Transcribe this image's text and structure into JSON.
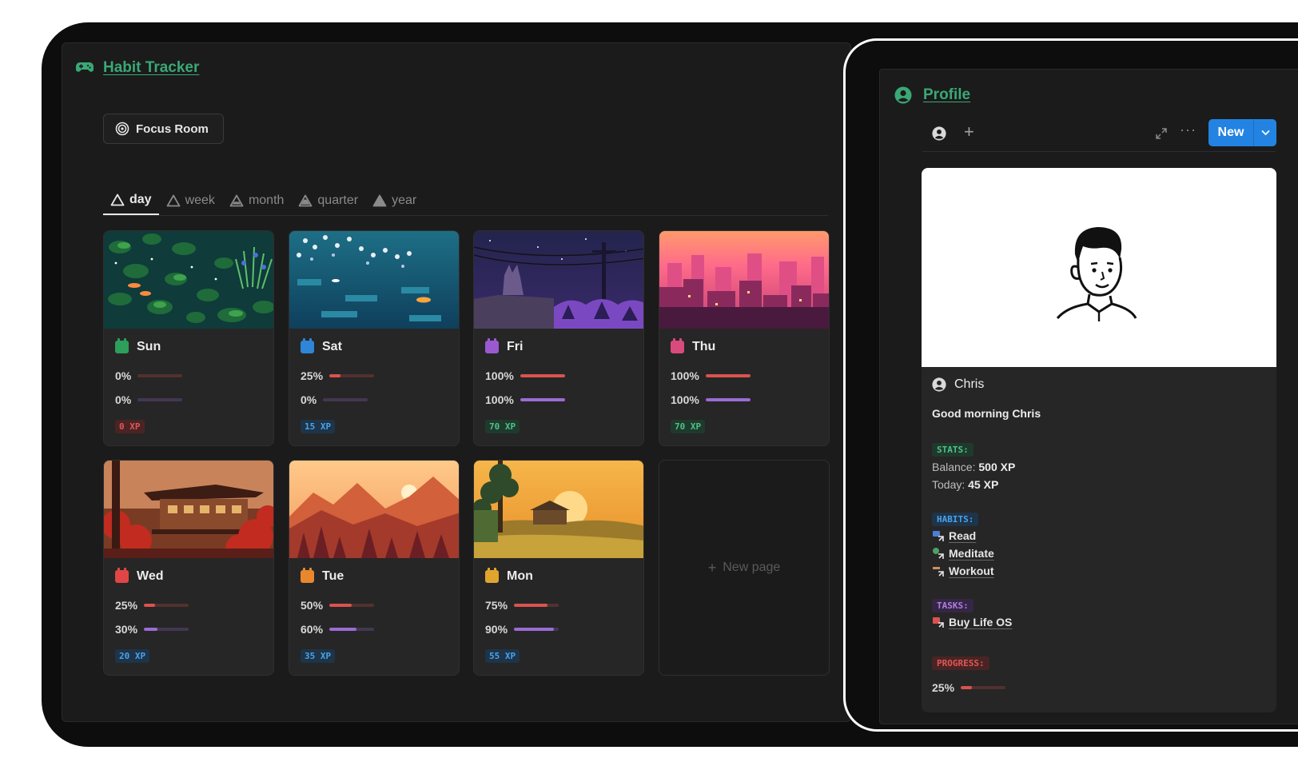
{
  "app": {
    "title": "Habit Tracker",
    "focus_button": "Focus Room"
  },
  "tabs": [
    {
      "label": "day",
      "active": true
    },
    {
      "label": "week",
      "active": false
    },
    {
      "label": "month",
      "active": false
    },
    {
      "label": "quarter",
      "active": false
    },
    {
      "label": "year",
      "active": false
    }
  ],
  "days": [
    {
      "name": "Sun",
      "p1_text": "0%",
      "p1": 0,
      "p2_text": "0%",
      "p2": 0,
      "xp": "0 XP",
      "cal_color": "#2e9e5b",
      "xp_color": "#e05757",
      "xp_bg": "#4a2424"
    },
    {
      "name": "Sat",
      "p1_text": "25%",
      "p1": 0.25,
      "p2_text": "0%",
      "p2": 0,
      "xp": "15 XP",
      "cal_color": "#2f86d6",
      "xp_color": "#4aa3e8",
      "xp_bg": "#1e3449"
    },
    {
      "name": "Fri",
      "p1_text": "100%",
      "p1": 1,
      "p2_text": "100%",
      "p2": 1,
      "xp": "70 XP",
      "cal_color": "#9b59d0",
      "xp_color": "#4fc08a",
      "xp_bg": "#1f3a2c"
    },
    {
      "name": "Thu",
      "p1_text": "100%",
      "p1": 1,
      "p2_text": "100%",
      "p2": 1,
      "xp": "70 XP",
      "cal_color": "#d94b7c",
      "xp_color": "#4fc08a",
      "xp_bg": "#1f3a2c"
    },
    {
      "name": "Wed",
      "p1_text": "25%",
      "p1": 0.25,
      "p2_text": "30%",
      "p2": 0.3,
      "xp": "20 XP",
      "cal_color": "#e04646",
      "xp_color": "#4aa3e8",
      "xp_bg": "#1e3449"
    },
    {
      "name": "Tue",
      "p1_text": "50%",
      "p1": 0.5,
      "p2_text": "60%",
      "p2": 0.6,
      "xp": "35 XP",
      "cal_color": "#e8872e",
      "xp_color": "#4aa3e8",
      "xp_bg": "#1e3449"
    },
    {
      "name": "Mon",
      "p1_text": "75%",
      "p1": 0.75,
      "p2_text": "90%",
      "p2": 0.9,
      "xp": "55 XP",
      "cal_color": "#e0a52e",
      "xp_color": "#4aa3e8",
      "xp_bg": "#1e3449"
    }
  ],
  "new_page": "New page",
  "profile": {
    "title": "Profile",
    "new_button": "New",
    "name": "Chris",
    "greeting": "Good morning Chris",
    "stats_tag": "STATS:",
    "balance_label": "Balance:",
    "balance_value": "500 XP",
    "today_label": "Today:",
    "today_value": "45 XP",
    "habits_tag": "HABITS:",
    "habits": [
      "Read",
      "Meditate",
      "Workout"
    ],
    "tasks_tag": "TASKS:",
    "tasks": [
      "Buy Life OS"
    ],
    "progress_tag": "PROGRESS:",
    "progress_text": "25%",
    "progress": 0.25
  },
  "colors": {
    "accent_green": "#3aa876",
    "bar_red": "#d9534f",
    "bar_purple": "#9b6bd6",
    "new_blue": "#2383e2"
  }
}
